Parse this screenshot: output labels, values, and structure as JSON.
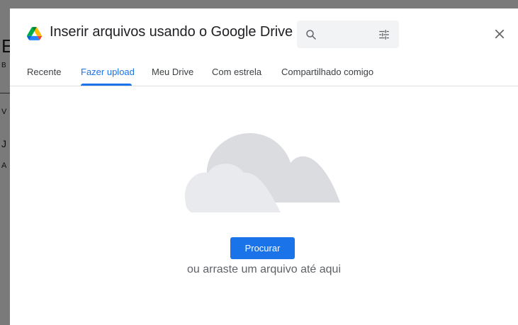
{
  "dialog": {
    "title": "Inserir arquivos usando o Google Drive",
    "logo_icon": "google-drive-logo",
    "search": {
      "value": "",
      "placeholder": "",
      "icon": "search-icon",
      "filter_icon": "tune-icon"
    },
    "close_icon": "close-icon"
  },
  "tabs": [
    {
      "label": "Recente",
      "active": false
    },
    {
      "label": "Fazer upload",
      "active": true
    },
    {
      "label": "Meu Drive",
      "active": false
    },
    {
      "label": "Com estrela",
      "active": false
    },
    {
      "label": "Compartilhado comigo",
      "active": false
    }
  ],
  "upload": {
    "illustration": "cloud-illustration",
    "browse_label": "Procurar",
    "drag_hint": "ou arraste um arquivo até aqui"
  },
  "colors": {
    "accent": "#1a73e8",
    "overlay": "#7a7a7a",
    "cloud_back": "#dadce0",
    "cloud_front": "#e8eaed"
  }
}
